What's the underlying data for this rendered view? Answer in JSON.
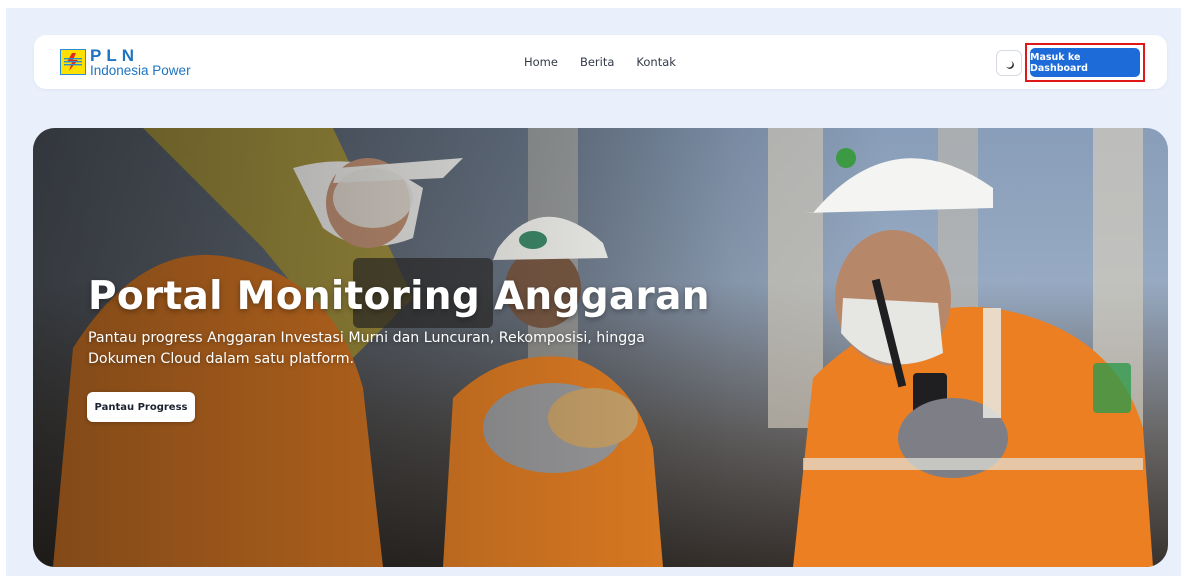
{
  "brand": {
    "name": "PLN",
    "subtitle": "Indonesia Power"
  },
  "nav": {
    "links": [
      "Home",
      "Berita",
      "Kontak"
    ]
  },
  "header": {
    "theme_toggle_icon": "moon-icon",
    "cta_label": "Masuk ke Dashboard"
  },
  "hero": {
    "title": "Portal Monitoring Anggaran",
    "subtitle": "Pantau progress Anggaran Investasi Murni dan Luncuran, Rekomposisi, hingga Dokumen Cloud dalam satu platform.",
    "button_label": "Pantau Progress"
  },
  "colors": {
    "accent": "#1d6bd8",
    "brand_yellow": "#ffe000",
    "brand_blue": "#1f74c0",
    "page_bg": "#eaf0fb",
    "highlight": "#e01818"
  }
}
